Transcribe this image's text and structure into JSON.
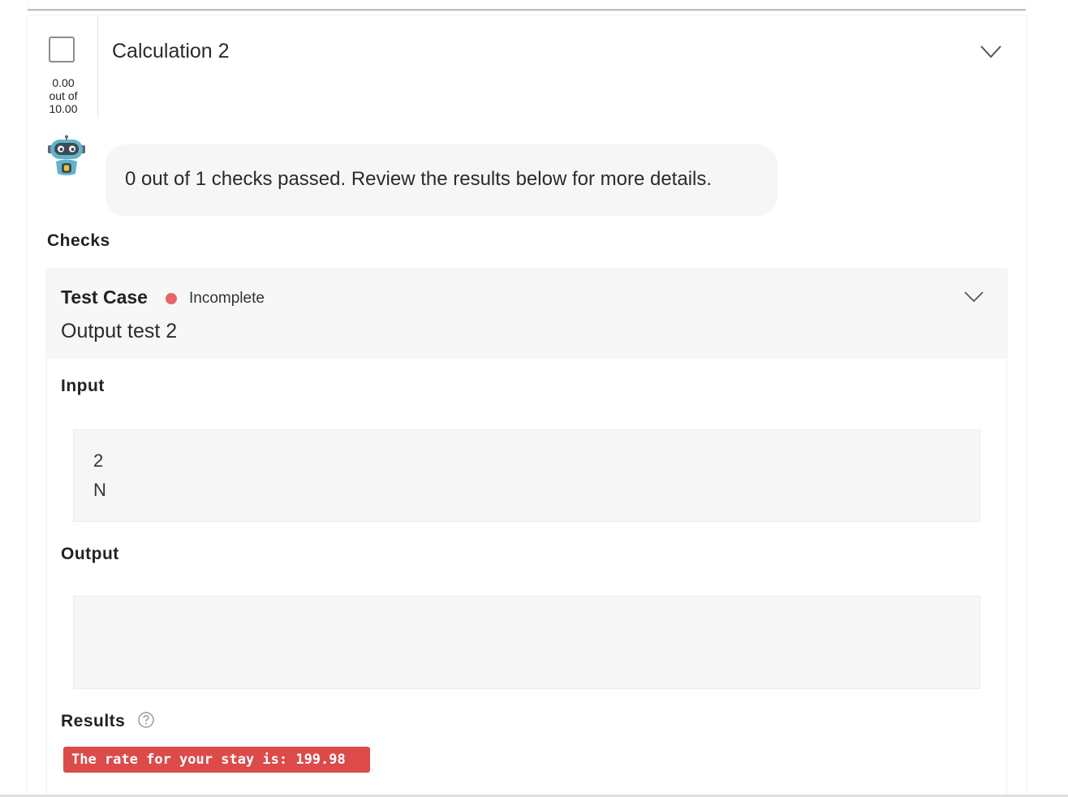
{
  "question": {
    "title": "Calculation 2",
    "score": "0.00",
    "score_mid": "out of",
    "score_total": "10.00"
  },
  "feedback": {
    "message": "0 out of 1 checks passed. Review the results below for more details."
  },
  "checks": {
    "label": "Checks",
    "test_case": {
      "type_label": "Test Case",
      "status": "Incomplete",
      "status_color": "#e8646a",
      "name": "Output test 2",
      "input_label": "Input",
      "input_lines": [
        "2",
        "N"
      ],
      "output_label": "Output",
      "output_lines": [],
      "results_label": "Results",
      "result_text": "The rate for your stay is: 199.98",
      "result_color": "#dc4a4a"
    }
  },
  "icons": {
    "expand": "chevron-down-icon",
    "help": "help-circle-icon",
    "avatar": "robot-icon"
  }
}
